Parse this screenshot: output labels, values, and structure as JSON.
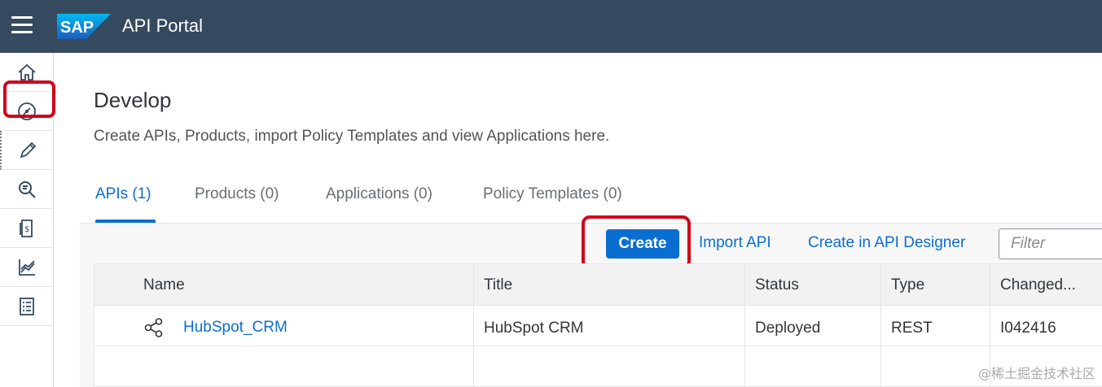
{
  "shell": {
    "logo_text": "SAP",
    "app_title": "API Portal"
  },
  "sidenav": {
    "items": [
      {
        "icon": "home-icon"
      },
      {
        "icon": "compass-icon"
      },
      {
        "icon": "pencil-icon"
      },
      {
        "icon": "discover-icon"
      },
      {
        "icon": "document-dollar-icon"
      },
      {
        "icon": "analytics-icon"
      },
      {
        "icon": "checklist-icon"
      }
    ]
  },
  "main": {
    "title": "Develop",
    "description": "Create APIs, Products, import Policy Templates and view Applications here.",
    "tabs": [
      {
        "label": "APIs (1)"
      },
      {
        "label": "Products (0)"
      },
      {
        "label": "Applications (0)"
      },
      {
        "label": "Policy Templates (0)"
      }
    ]
  },
  "toolbar": {
    "create_label": "Create",
    "import_label": "Import API",
    "designer_label": "Create in API Designer",
    "filter_placeholder": "Filter"
  },
  "table": {
    "columns": [
      "Name",
      "Title",
      "Status",
      "Type",
      "Changed..."
    ],
    "rows": [
      {
        "name": "HubSpot_CRM",
        "title": "HubSpot CRM",
        "status": "Deployed",
        "type": "REST",
        "changed": "I042416"
      }
    ]
  },
  "watermark": "@稀土掘金技术社区",
  "colors": {
    "shellbar": "#354a5f",
    "accent": "#0a6ed1",
    "highlight": "#d0021b"
  }
}
